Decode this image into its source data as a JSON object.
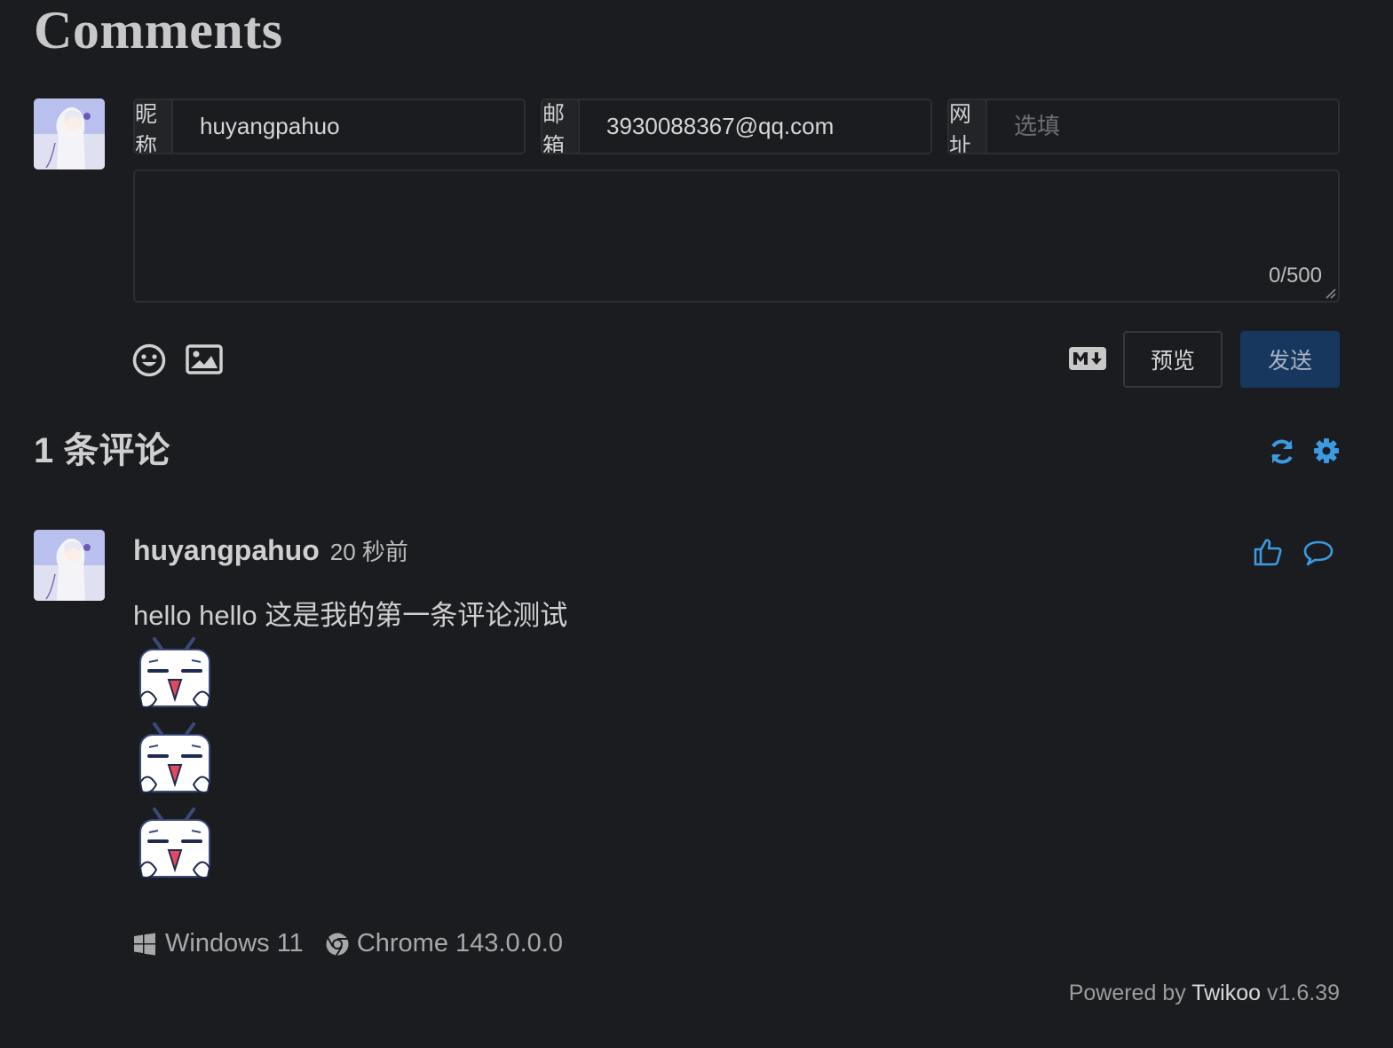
{
  "title": "Comments",
  "form": {
    "nick_label": "昵称",
    "nick_value": "huyangpahuo",
    "mail_label": "邮箱",
    "mail_value": "3930088367@qq.com",
    "link_label": "网址",
    "link_placeholder": "选填",
    "char_count": "0/500",
    "emoji_icon": "smiley-face-icon",
    "image_icon": "image-upload-icon",
    "markdown_icon": "markdown-icon",
    "preview_label": "预览",
    "send_label": "发送"
  },
  "comments_header": {
    "count_text": "1 条评论",
    "refresh_icon": "refresh-icon",
    "settings_icon": "gear-icon",
    "accent_color": "#3b9ae1"
  },
  "comments": [
    {
      "nick": "huyangpahuo",
      "time": "20 秒前",
      "text": "hello hello 这是我的第一条评论测试",
      "stickers": [
        "bilibili-tv-sticker",
        "bilibili-tv-sticker",
        "bilibili-tv-sticker"
      ],
      "os": "Windows 11",
      "browser": "Chrome 143.0.0.0",
      "like_icon": "thumbs-up-icon",
      "reply_icon": "speech-bubble-icon"
    }
  ],
  "footer": {
    "powered_prefix": "Powered by",
    "powered_brand": "Twikoo",
    "powered_version": "v1.6.39"
  }
}
